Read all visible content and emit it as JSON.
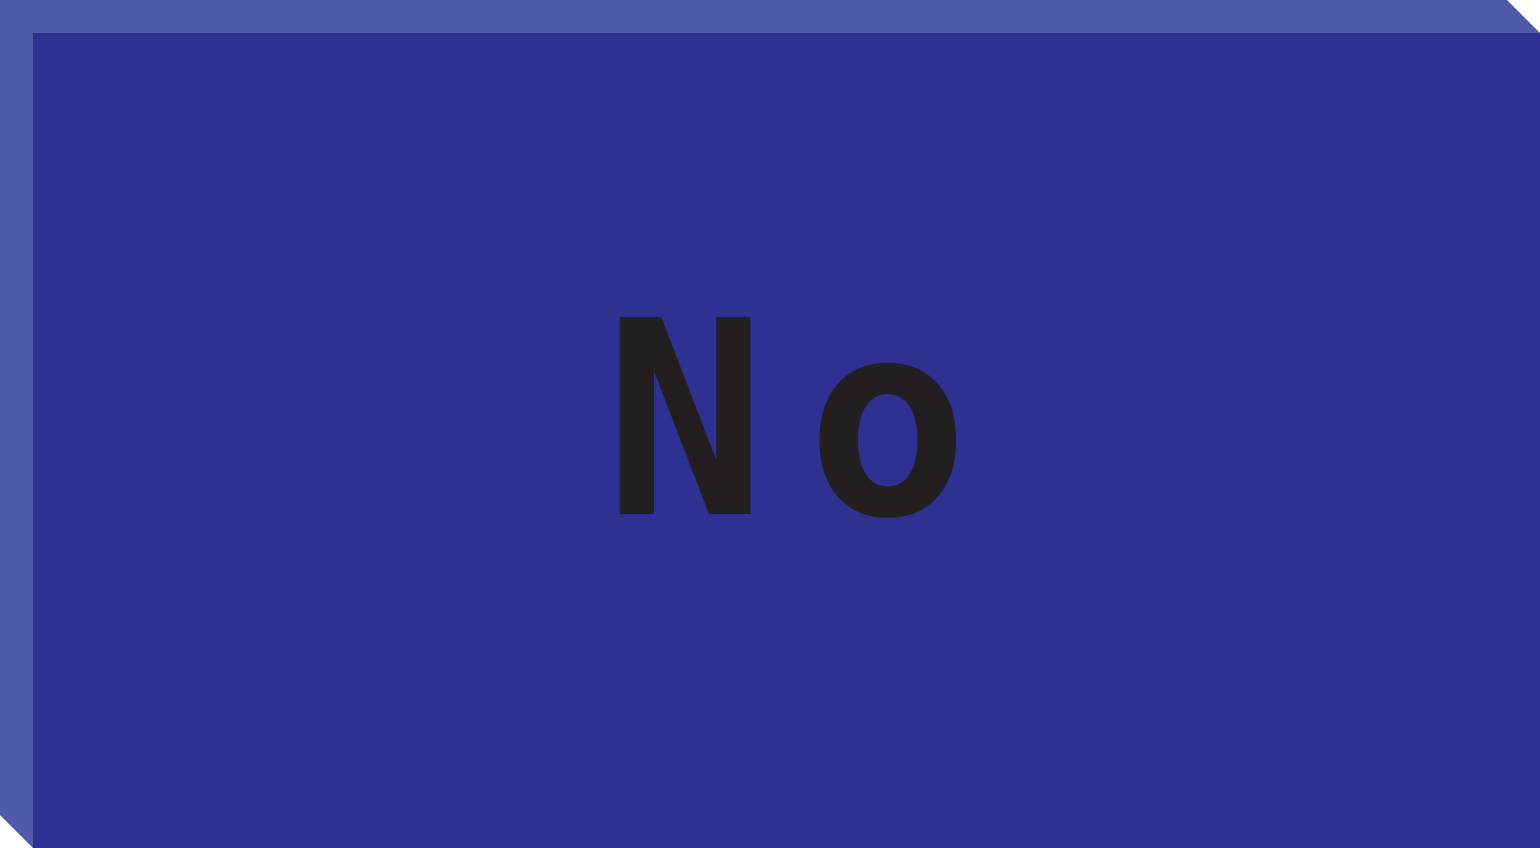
{
  "button": {
    "label": "No"
  },
  "colors": {
    "face": "#2e3192",
    "bevel_highlight": "#4d5ba8",
    "label_text": "#231f20"
  }
}
